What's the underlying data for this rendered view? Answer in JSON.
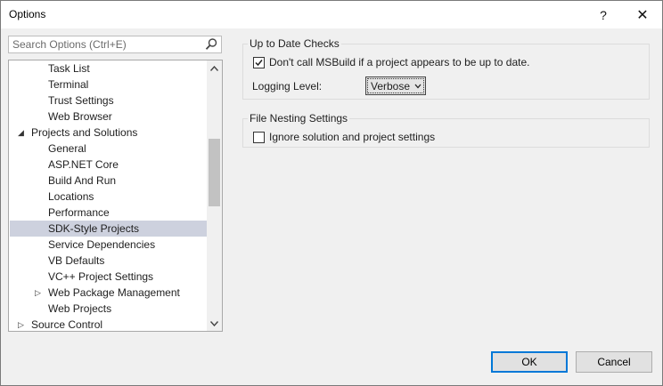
{
  "window": {
    "title": "Options",
    "help_glyph": "?",
    "close_glyph": "✕"
  },
  "search": {
    "placeholder": "Search Options (Ctrl+E)"
  },
  "tree": {
    "items": [
      {
        "label": "Task List"
      },
      {
        "label": "Terminal"
      },
      {
        "label": "Trust Settings"
      },
      {
        "label": "Web Browser"
      },
      {
        "label": "Projects and Solutions",
        "expander": "◢"
      },
      {
        "label": "General"
      },
      {
        "label": "ASP.NET Core"
      },
      {
        "label": "Build And Run"
      },
      {
        "label": "Locations"
      },
      {
        "label": "Performance"
      },
      {
        "label": "SDK-Style Projects",
        "selected": true
      },
      {
        "label": "Service Dependencies"
      },
      {
        "label": "VB Defaults"
      },
      {
        "label": "VC++ Project Settings"
      },
      {
        "label": "Web Package Management",
        "expander": "▷"
      },
      {
        "label": "Web Projects"
      },
      {
        "label": "Source Control",
        "expander": "▷"
      }
    ]
  },
  "up_to_date": {
    "group_title": "Up to Date Checks",
    "checkbox_label": "Don't call MSBuild if a project appears to be up to date.",
    "checked": true,
    "logging_label": "Logging Level:",
    "logging_value": "Verbose"
  },
  "file_nesting": {
    "group_title": "File Nesting Settings",
    "checkbox_label": "Ignore solution and project settings",
    "checked": false
  },
  "buttons": {
    "ok": "OK",
    "cancel": "Cancel"
  },
  "colors": {
    "accent": "#0078d7",
    "selection": "#cdd1de"
  }
}
